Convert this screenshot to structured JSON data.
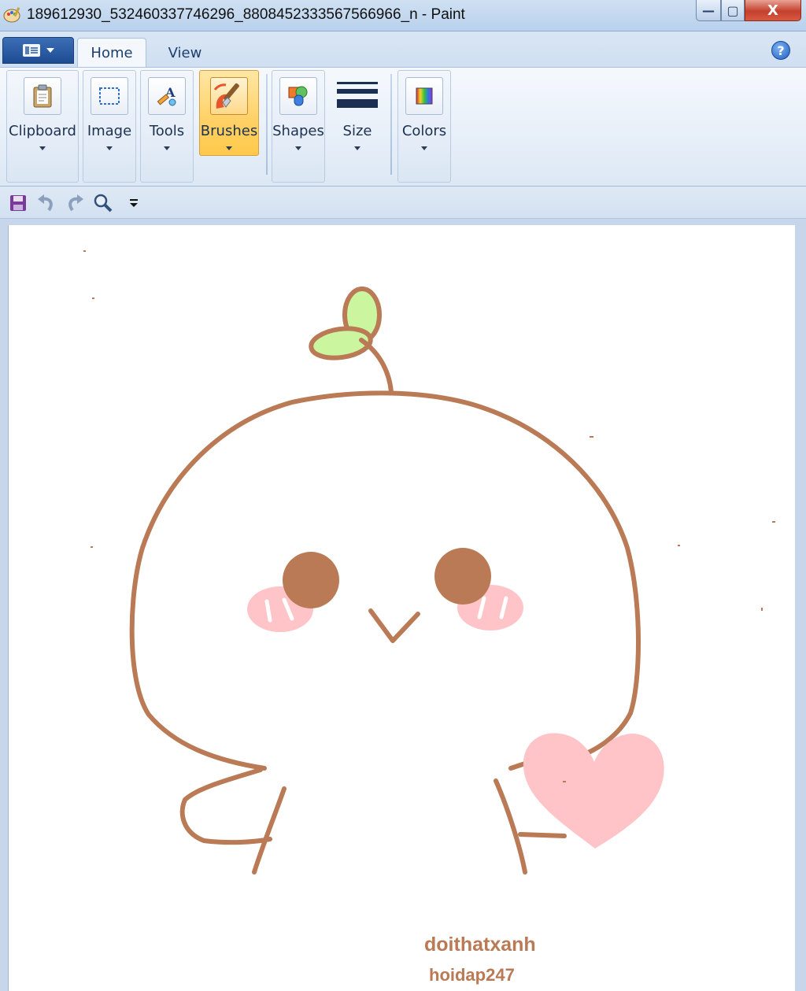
{
  "window": {
    "title": "189612930_532460337746296_8808452333567566966_n - Paint",
    "minimize_glyph": "—",
    "maximize_glyph": "▢",
    "close_glyph": "X"
  },
  "ribbon_tabs": {
    "home": "Home",
    "view": "View",
    "help_glyph": "?"
  },
  "ribbon_groups": {
    "clipboard": "Clipboard",
    "image": "Image",
    "tools": "Tools",
    "brushes": "Brushes",
    "shapes": "Shapes",
    "size": "Size",
    "colors": "Colors"
  },
  "icons": {
    "app": "paint-palette-icon",
    "clipboard": "clipboard-icon",
    "image": "select-rectangle-icon",
    "tools": "pencil-text-icon",
    "brushes": "paintbrush-icon",
    "shapes": "shapes-icon",
    "size": "line-size-icon",
    "colors": "color-palette-icon",
    "save": "save-icon",
    "undo": "undo-icon",
    "redo": "redo-icon",
    "zoom": "magnifier-icon",
    "customize": "dropdown-icon"
  },
  "colors": {
    "outline": "#b97a55",
    "leaf": "#ccf5a0",
    "blush": "#ffc4c8",
    "heart": "#ffc4c8",
    "active_group": "#ffd165"
  },
  "canvas_text": {
    "signature_1": "doithatxanh",
    "signature_2": "hoidap247"
  }
}
